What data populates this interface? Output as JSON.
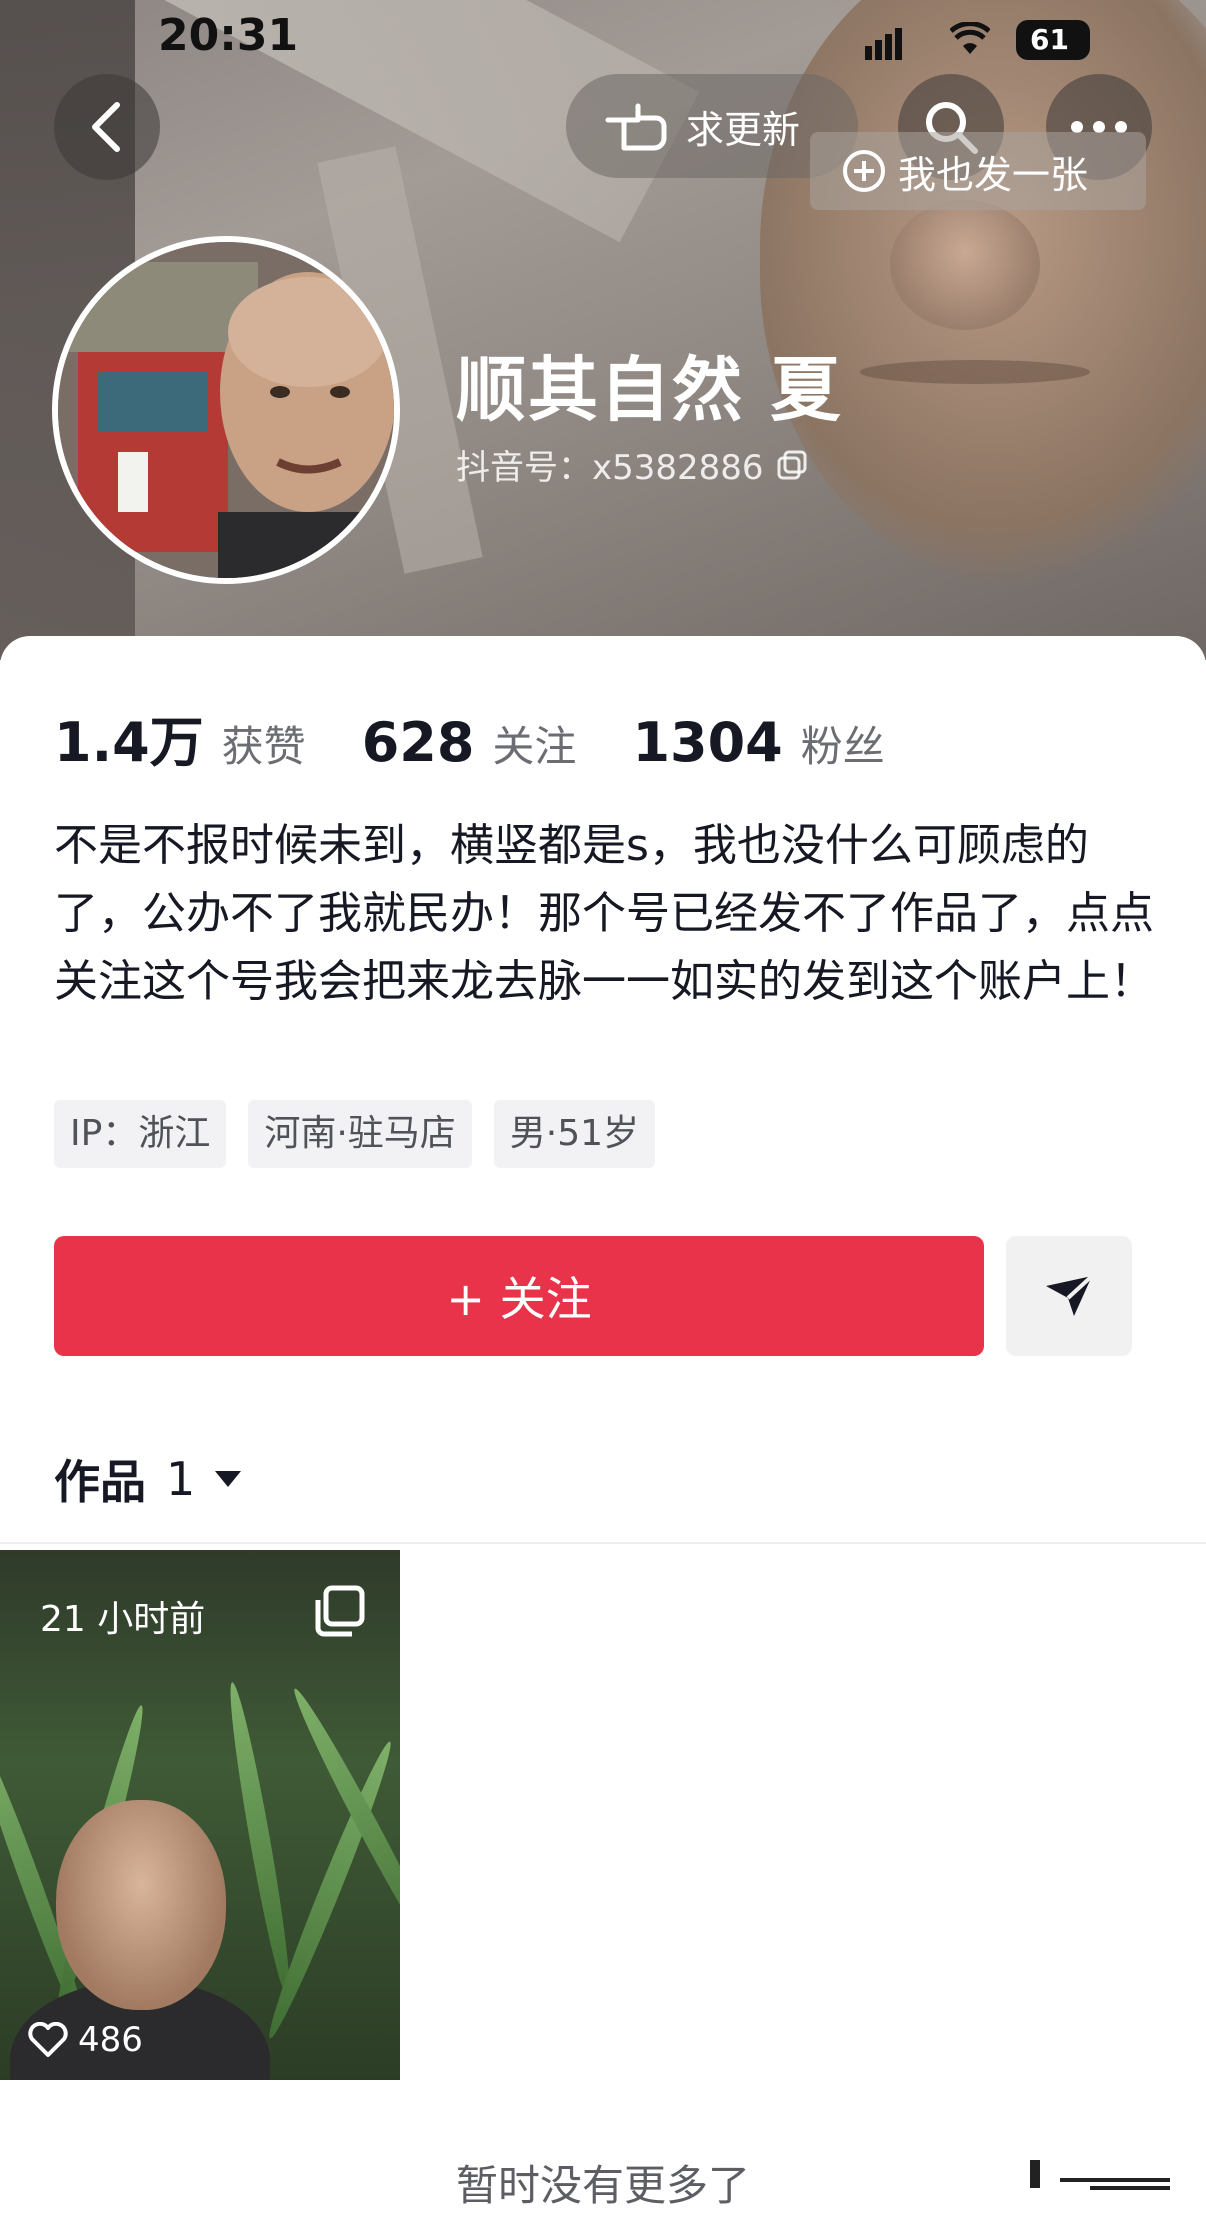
{
  "status_bar": {
    "time": "20:31",
    "battery": "61"
  },
  "header": {
    "request_update_label": "求更新",
    "post_tip_label": "我也发一张"
  },
  "profile": {
    "nickname": "顺其自然 夏",
    "douyin_id": "抖音号：x5382886"
  },
  "stats": [
    {
      "value": "1.4万",
      "label": "获赞"
    },
    {
      "value": "628",
      "label": "关注"
    },
    {
      "value": "1304",
      "label": "粉丝"
    }
  ],
  "bio": "不是不报时候未到，横竖都是s，我也没什么可顾虑的了，公办不了我就民办！那个号已经发不了作品了，点点关注这个号我会把来龙去脉一一如实的发到这个账户上！",
  "tags": [
    "IP：浙江",
    "河南·驻马店",
    "男·51岁"
  ],
  "follow_button": "+ 关注",
  "works": {
    "tab_label": "作品",
    "count": "1",
    "items": [
      {
        "time_ago": "21 小时前",
        "likes": "486"
      }
    ]
  },
  "footer_text": "暂时没有更多了",
  "colors": {
    "follow": "#e8334a",
    "tag_bg": "#f2f2f4"
  }
}
